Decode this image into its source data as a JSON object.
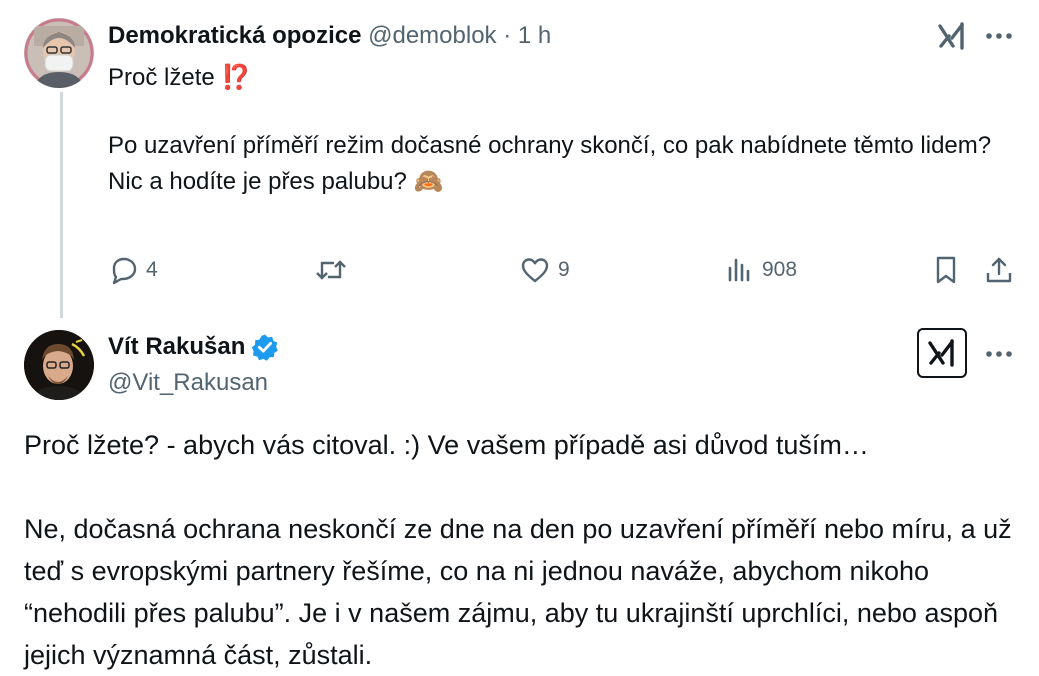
{
  "tweet1": {
    "author_name": "Demokratická opozice",
    "handle": "@demoblok",
    "separator": "·",
    "time": "1 h",
    "title_line": "Proč lžete",
    "title_emoji": "⁉️",
    "body": "Po uzavření příměří režim dočasné ochrany skončí, co pak nabídnete těmto lidem? Nic a hodíte je přes palubu?",
    "body_emoji": "🙈",
    "replies": "4",
    "likes": "9",
    "views": "908"
  },
  "tweet2": {
    "author_name": "Vít Rakušan",
    "handle": "@Vit_Rakusan",
    "paragraphs": [
      "Proč lžete? - abych vás citoval. :) Ve vašem případě asi důvod tuším…",
      "Ne, dočasná ochrana neskončí ze dne na den po uzavření příměří nebo míru, a už teď s evropskými partnery řešíme, co na ni jednou naváže, abychom nikoho “nehodili přes palubu”. Je i v našem zájmu, aby tu ukrajinští uprchlíci, nebo aspoň jejich významná část, zůstali."
    ]
  },
  "icons": {
    "reply": "reply-icon",
    "retweet": "retweet-icon",
    "like": "heart-icon",
    "views": "views-icon",
    "bookmark": "bookmark-icon",
    "share": "share-icon",
    "more": "more-icon",
    "grok": "xai-icon",
    "verified": "verified-badge-icon"
  },
  "colors": {
    "text": "#0f1419",
    "muted": "#536471",
    "verified": "#1d9bf0",
    "title_emoji": "#e0245e",
    "thread_line": "#cfd9de"
  }
}
